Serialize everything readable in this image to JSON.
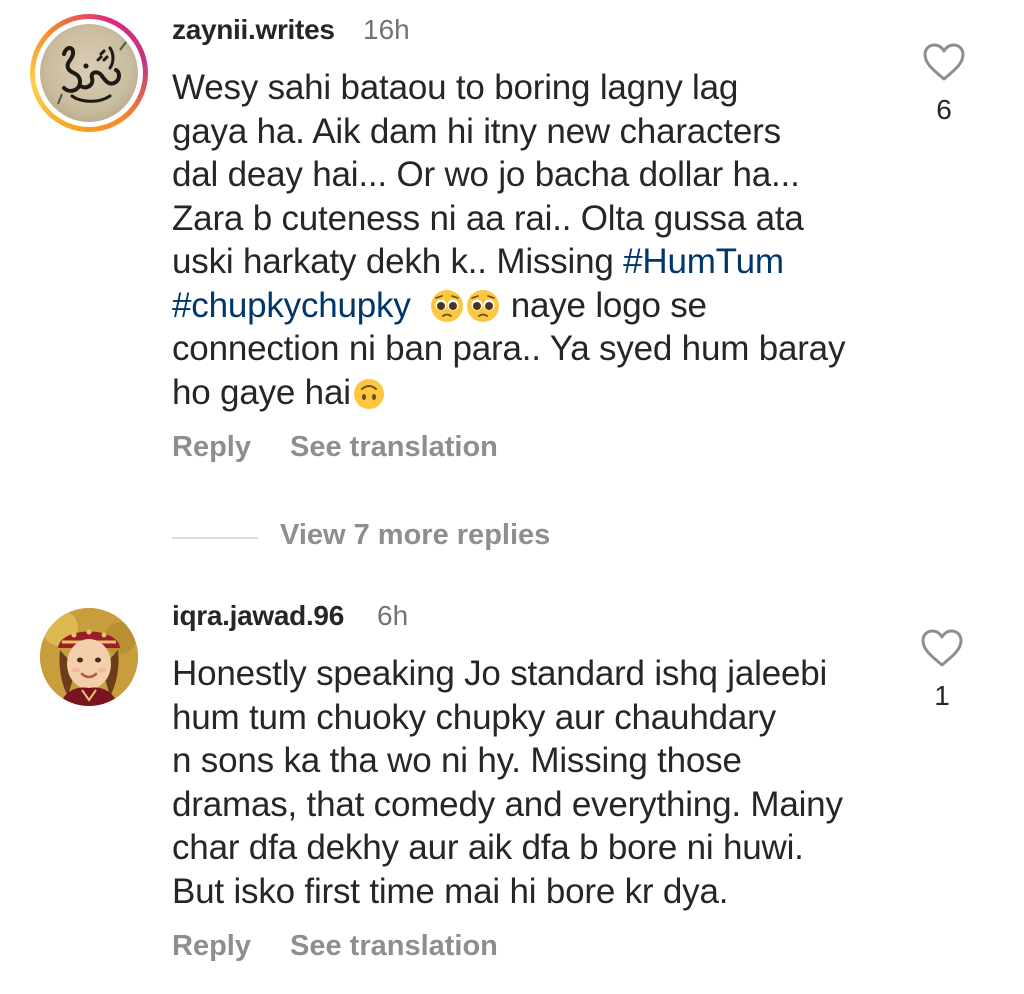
{
  "comments": [
    {
      "username": "zaynii.writes",
      "time": "16h",
      "avatar": "calligraphy-avatar-ishq",
      "text_lines": [
        "Wesy sahi bataou to boring lagny lag",
        "gaya ha. Aik dam hi itny new characters",
        "dal deay hai... Or wo jo bacha dollar ha...",
        "Zara b cuteness ni aa rai.. Olta gussa ata"
      ],
      "line5_prefix": "uski harkaty dekh k.. Missing ",
      "hashtag1": "#HumTum",
      "hashtag2": "#chupkychupky",
      "line6_suffix": " naye logo se",
      "line7": "connection ni ban para.. Ya syed hum baray",
      "line8": "ho gaye hai",
      "likes": "6",
      "reply_label": "Reply",
      "translate_label": "See translation"
    },
    {
      "username": "iqra.jawad.96",
      "time": "6h",
      "avatar": "girl-photo-avatar",
      "text_lines": [
        "Honestly speaking Jo standard ishq jaleebi",
        "hum tum chuoky chupky aur chauhdary",
        "n sons ka tha wo ni hy. Missing those",
        "dramas, that comedy and everything. Mainy",
        "char dfa dekhy aur aik dfa b bore ni huwi.",
        "But isko first time mai hi bore kr dya."
      ],
      "likes": "1",
      "reply_label": "Reply",
      "translate_label": "See translation"
    }
  ],
  "view_replies_label": "View 7 more replies",
  "colors": {
    "text": "#262626",
    "muted": "#8e8e8e",
    "hashtag": "#00376b"
  },
  "icons": [
    "heart-icon",
    "pleading-face-emoji",
    "upside-down-face-emoji"
  ]
}
